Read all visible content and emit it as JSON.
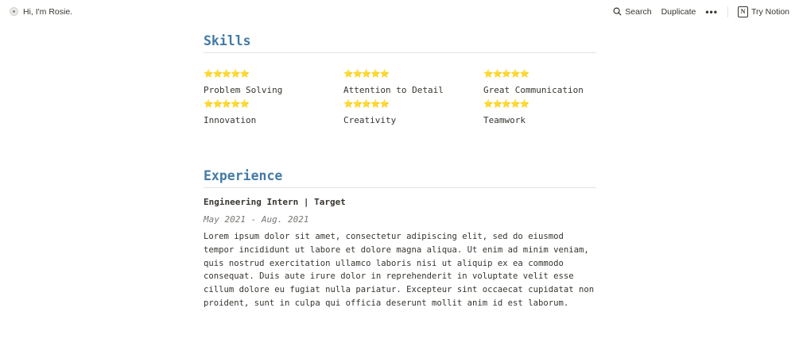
{
  "topbar": {
    "page_title": "Hi, I'm Rosie.",
    "search_label": "Search",
    "duplicate_label": "Duplicate",
    "more_label": "•••",
    "try_notion_label": "Try Notion",
    "notion_logo_letter": "N"
  },
  "skills": {
    "title": "Skills",
    "stars": "⭐⭐⭐⭐⭐",
    "items": [
      {
        "name": "Problem Solving",
        "rating": 5
      },
      {
        "name": "Attention to Detail",
        "rating": 5
      },
      {
        "name": "Great Communication",
        "rating": 5
      },
      {
        "name": "Innovation",
        "rating": 5
      },
      {
        "name": "Creativity",
        "rating": 5
      },
      {
        "name": "Teamwork",
        "rating": 5
      }
    ]
  },
  "experience": {
    "title": "Experience",
    "jobs": [
      {
        "title": "Engineering Intern | Target",
        "dates": "May 2021 - Aug. 2021",
        "description": "Lorem ipsum dolor sit amet, consectetur adipiscing elit, sed do eiusmod tempor incididunt ut labore et dolore magna aliqua. Ut enim ad minim veniam, quis nostrud exercitation ullamco laboris nisi ut aliquip ex ea commodo consequat. Duis aute irure dolor in reprehenderit in voluptate velit esse cillum dolore eu fugiat nulla pariatur. Excepteur sint occaecat cupidatat non proident, sunt in culpa qui officia deserunt mollit anim id est laborum."
      }
    ]
  },
  "colors": {
    "heading": "#447aa6",
    "star": "#f2c12e",
    "text": "#37352f",
    "muted": "#787774"
  },
  "icons": [
    "page-icon",
    "search-icon",
    "more-icon",
    "notion-logo-icon",
    "star-icon"
  ]
}
